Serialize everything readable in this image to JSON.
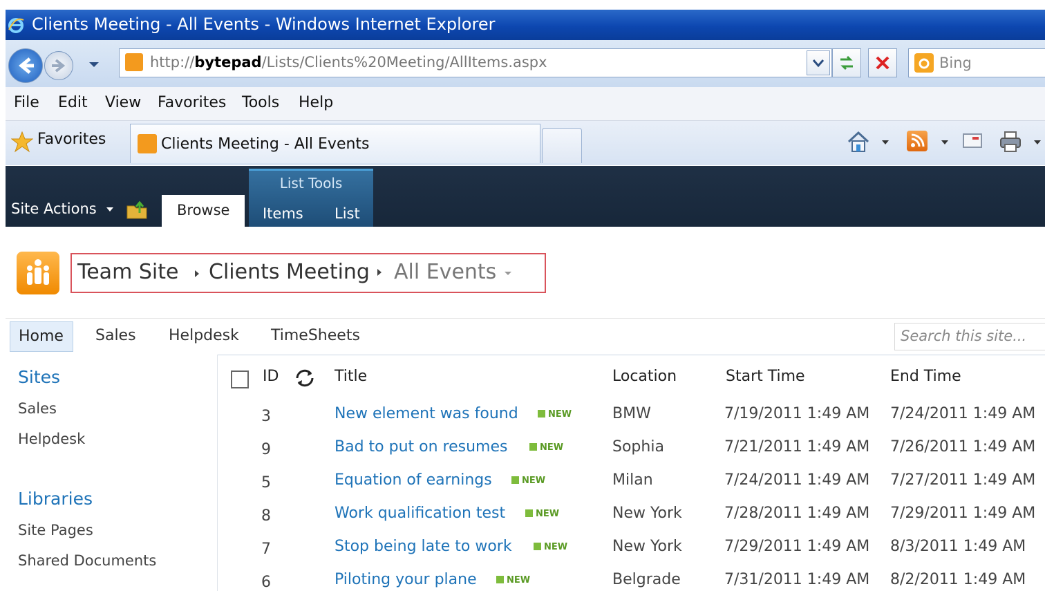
{
  "browser": {
    "window_title": "Clients Meeting - All Events - Windows Internet Explorer",
    "url_prefix": "http://",
    "url_host": "bytepad",
    "url_path": "/Lists/Clients%20Meeting/AllItems.aspx",
    "search_engine": "Bing",
    "menu": [
      "File",
      "Edit",
      "View",
      "Favorites",
      "Tools",
      "Help"
    ],
    "favorites_label": "Favorites",
    "tab_title": "Clients Meeting - All Events"
  },
  "ribbon": {
    "site_actions": "Site Actions",
    "browse_tab": "Browse",
    "context_group": "List Tools",
    "context_tabs": [
      "Items",
      "List"
    ]
  },
  "breadcrumb": {
    "site": "Team Site",
    "list": "Clients Meeting",
    "view": "All Events"
  },
  "topnav": {
    "items": [
      "Home",
      "Sales",
      "Helpdesk",
      "TimeSheets"
    ],
    "search_placeholder": "Search this site..."
  },
  "quick_launch": {
    "sites_heading": "Sites",
    "sites": [
      "Sales",
      "Helpdesk"
    ],
    "libraries_heading": "Libraries",
    "libraries": [
      "Site Pages",
      "Shared Documents"
    ]
  },
  "list": {
    "columns": [
      "ID",
      "Title",
      "Location",
      "Start Time",
      "End Time"
    ],
    "new_badge": "NEW",
    "rows": [
      {
        "id": "3",
        "title": "New element was found",
        "location": "BMW",
        "start": "7/19/2011 1:49 AM",
        "end": "7/24/2011 1:49 AM"
      },
      {
        "id": "9",
        "title": "Bad to put on resumes",
        "location": "Sophia",
        "start": "7/21/2011 1:49 AM",
        "end": "7/26/2011 1:49 AM"
      },
      {
        "id": "5",
        "title": "Equation of earnings",
        "location": "Milan",
        "start": "7/24/2011 1:49 AM",
        "end": "7/27/2011 1:49 AM"
      },
      {
        "id": "8",
        "title": "Work qualification test",
        "location": "New York",
        "start": "7/28/2011 1:49 AM",
        "end": "7/29/2011 1:49 AM"
      },
      {
        "id": "7",
        "title": "Stop being late to work",
        "location": "New York",
        "start": "7/29/2011 1:49 AM",
        "end": "8/3/2011 1:49 AM"
      },
      {
        "id": "6",
        "title": "Piloting your plane",
        "location": "Belgrade",
        "start": "7/31/2011 1:49 AM",
        "end": "8/2/2011 1:49 AM"
      }
    ]
  },
  "colors": {
    "link": "#1e73b8",
    "ribbon": "#1b2b3f",
    "breadcrumb_border": "#d9535b",
    "new_badge": "#5a9a24"
  }
}
